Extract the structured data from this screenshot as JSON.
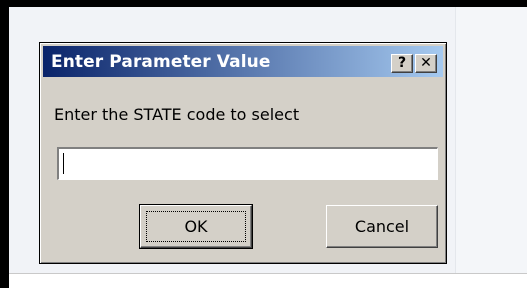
{
  "dialog": {
    "title": "Enter Parameter Value",
    "help_label": "?",
    "close_label": "✕",
    "prompt": "Enter the STATE code to select",
    "input_value": "",
    "ok_label": "OK",
    "cancel_label": "Cancel"
  },
  "colors": {
    "titlebar_start": "#0a246a",
    "titlebar_end": "#a6caf0",
    "dialog_face": "#d4d0c8"
  }
}
